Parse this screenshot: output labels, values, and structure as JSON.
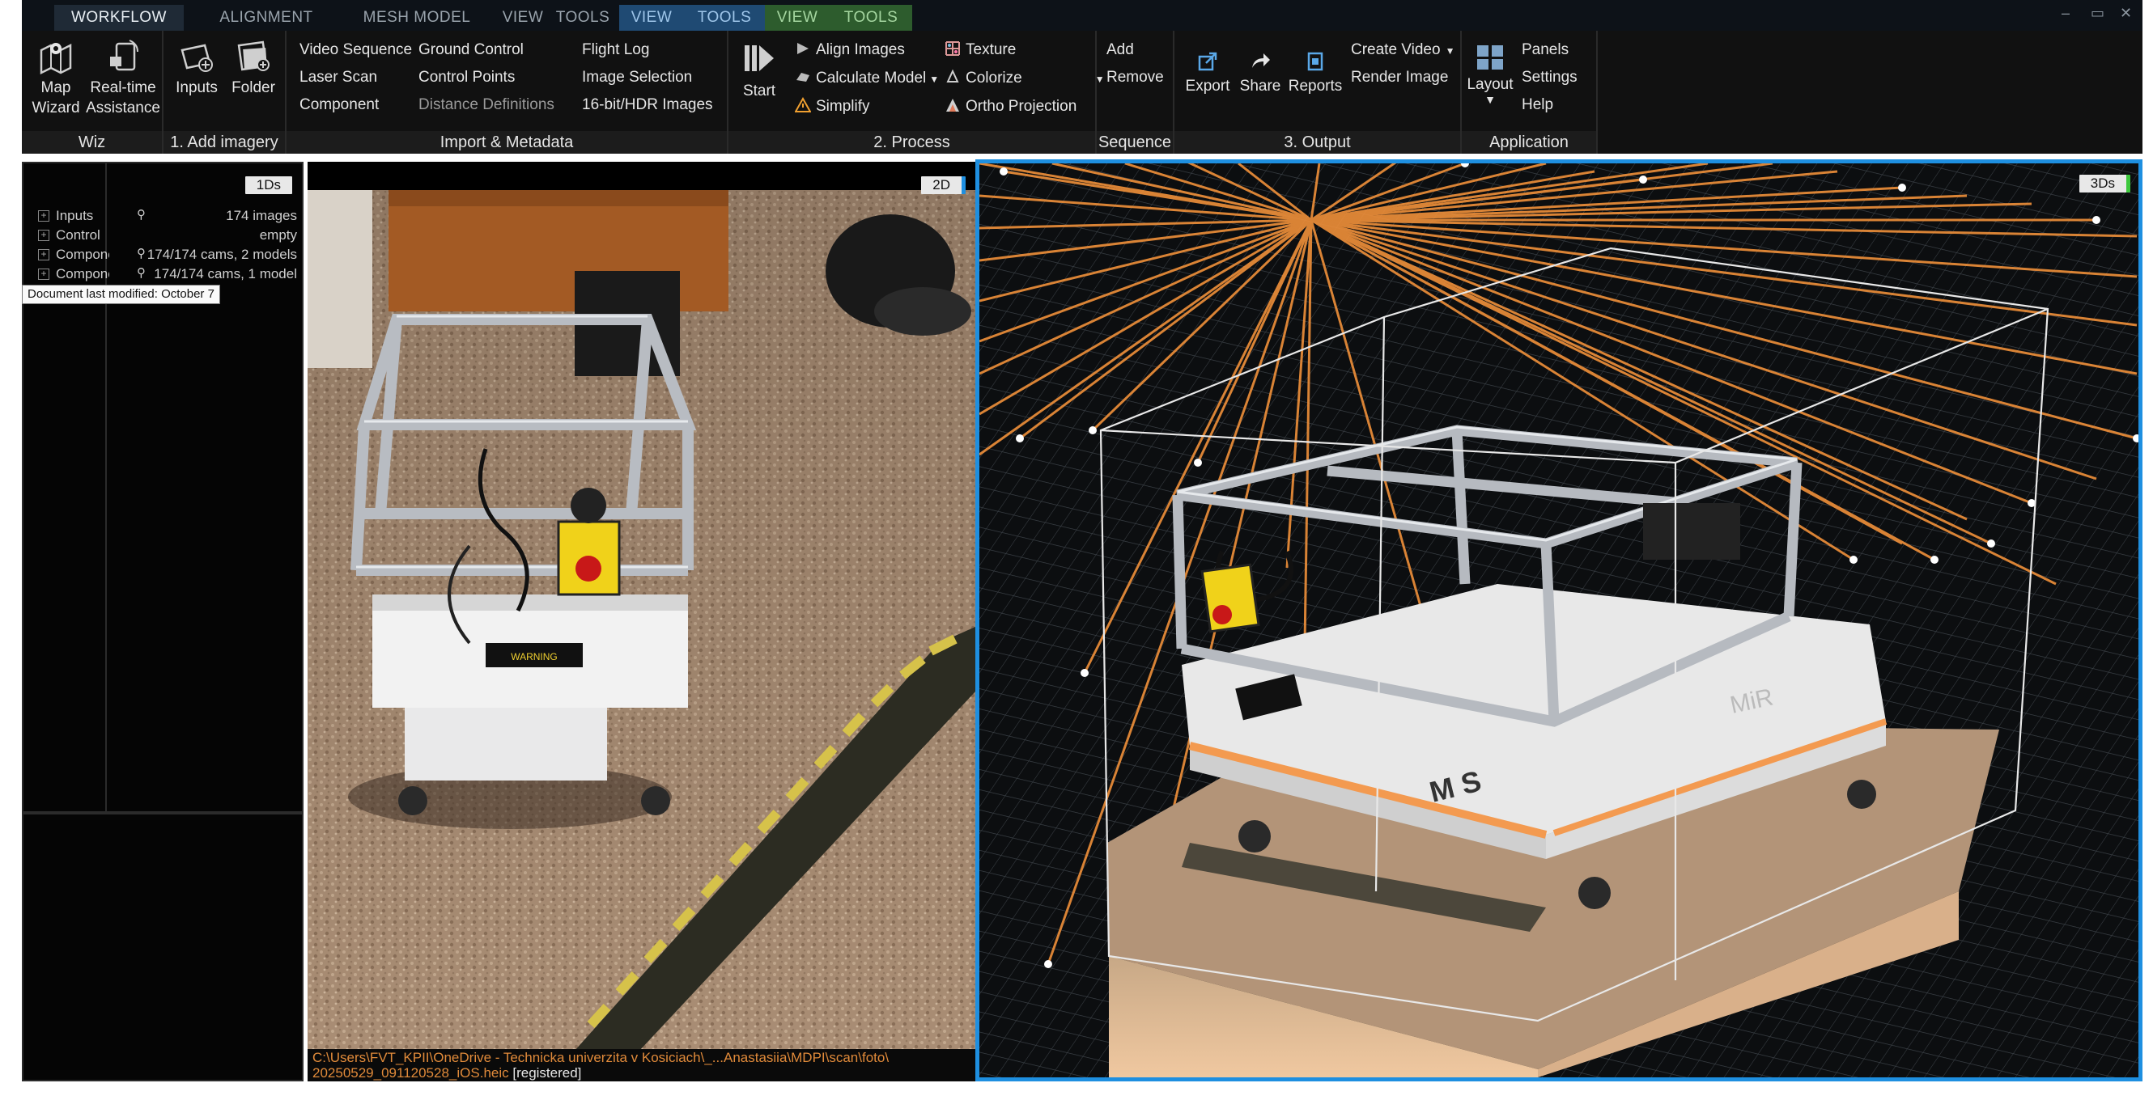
{
  "tabs": [
    "WORKFLOW",
    "ALIGNMENT",
    "MESH MODEL",
    "VIEW",
    "TOOLS",
    "VIEW",
    "TOOLS",
    "VIEW",
    "TOOLS"
  ],
  "ribbon": {
    "wiz": {
      "footer": "Wiz",
      "map_wizard": [
        "Map",
        "Wizard"
      ],
      "realtime": [
        "Real-time",
        "Assistance"
      ]
    },
    "add_imagery": {
      "footer": "1. Add imagery",
      "inputs": "Inputs",
      "folder": "Folder"
    },
    "import_metadata": {
      "footer": "Import & Metadata",
      "col1": [
        "Video Sequence",
        "Laser Scan",
        "Component"
      ],
      "col2": [
        "Ground Control",
        "Control Points",
        "Distance Definitions"
      ],
      "col3": [
        "Flight Log",
        "Image Selection",
        "16-bit/HDR Images"
      ]
    },
    "process": {
      "footer": "2. Process",
      "start": "Start",
      "col1": [
        "Align Images",
        "Calculate Model",
        "Simplify"
      ],
      "col2": [
        "Texture",
        "Colorize",
        "Ortho Projection"
      ]
    },
    "sequence": {
      "footer": "Sequence",
      "add": "Add",
      "remove": "Remove"
    },
    "output": {
      "footer": "3. Output",
      "export": "Export",
      "share": "Share",
      "reports": "Reports",
      "create_video": "Create Video",
      "render_image": "Render Image"
    },
    "application": {
      "footer": "Application",
      "layout": "Layout",
      "panels": "Panels",
      "settings": "Settings",
      "help": "Help"
    }
  },
  "left_panel": {
    "badge": "1Ds",
    "rows": [
      {
        "name": "Inputs",
        "pin": true,
        "value": "174 images"
      },
      {
        "name": "Control",
        "pin": false,
        "value": "empty"
      },
      {
        "name": "Component",
        "pin": true,
        "value": "174/174 cams, 2 models"
      },
      {
        "name": "Component",
        "pin": true,
        "value": "174/174 cams, 1 model"
      }
    ],
    "tooltip": "Document last modified: October 7"
  },
  "view2d": {
    "badge": "2D",
    "path_line1": "C:\\Users\\FVT_KPII\\OneDrive - Technicka univerzita v Kosiciach\\_...Anastasiia\\MDPI\\scan\\foto\\",
    "path_line2_file": "20250529_091120528_iOS.heic",
    "path_line2_status": "[registered]",
    "warning_label": "WARNING"
  },
  "view3d": {
    "badge": "3Ds",
    "robot_brand": "MiR",
    "robot_logo": "M S"
  },
  "colors": {
    "accent_blue": "#1e8fe0",
    "camera_ray": "#f0903a",
    "path_text": "#e08a3a"
  }
}
